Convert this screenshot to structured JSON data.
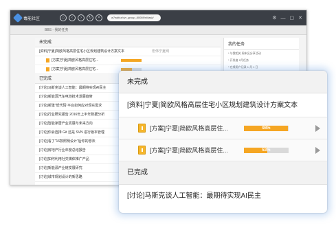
{
  "app": {
    "name": "毒能社区",
    "url": "w7wdfzz/dvr_group_80089/nl/task/",
    "breadcrumb": "BBS - 我的任务"
  },
  "sidebar": {
    "title": "我的任务",
    "items": [
      "* 与我相关 周末见分享活动",
      "* 开发者 2月任务",
      "* 在线用户记录 1 月 1 日",
      "* 近日 2016.1.15 与我相关发帖数据",
      "* 新手入门 2016 积分统计数据"
    ]
  },
  "bg_list": {
    "unfinished_label": "未完成",
    "main_item": "[资料]宁夏|简欧风格高层住宅小区规划建筑设计方案文本",
    "main_item_status": "宏伟宁夏网",
    "sub_items": [
      {
        "text": "[方案]宁夏|简欧风格高层住宅...",
        "progress": 98
      },
      {
        "text": "[方案]宁夏|简欧风格高层住宅...",
        "progress": 53
      }
    ],
    "done_label": "已完成",
    "done_items": [
      "[讨论]马斯克谈人工智能：最期待实现AI民主",
      "[讨论]新能源汽车电池技术发展趋势",
      "[讨论]新建“低代码”平台如何应对现实需求",
      "[讨论]行业研究报告 2016年上半年数据分析",
      "[讨论]智能家居产业发展与未来方向",
      "[讨论]你会选择 Git 还是 SVN 进行版本管理",
      "[讨论]看了“16款照明设计”后你的想法",
      "[讨论]房地产行业年度总结报告",
      "[讨论]如何利用社交媒体推广产品",
      "[讨论]新能源产业链发展研究",
      "[讨论]城市规划设计的新思路"
    ]
  },
  "card": {
    "unfinished_label": "未完成",
    "main_item": "[资料]宁夏|简欧风格高层住宅小区规划建筑设计方案文本",
    "sub_items": [
      {
        "text": "[方案]宁夏|简欧风格高层住...",
        "progress": 98,
        "progress_label": "98%"
      },
      {
        "text": "[方案]宁夏|简欧风格高层住...",
        "progress": 53,
        "progress_label": "53%"
      }
    ],
    "done_label": "已完成",
    "done_items": [
      "[讨论]马斯克谈人工智能：最期待实现AI民主"
    ]
  },
  "colors": {
    "titlebar": "#3b3f46",
    "progress": "#f5a623",
    "accent_glow": "#78aae6"
  }
}
